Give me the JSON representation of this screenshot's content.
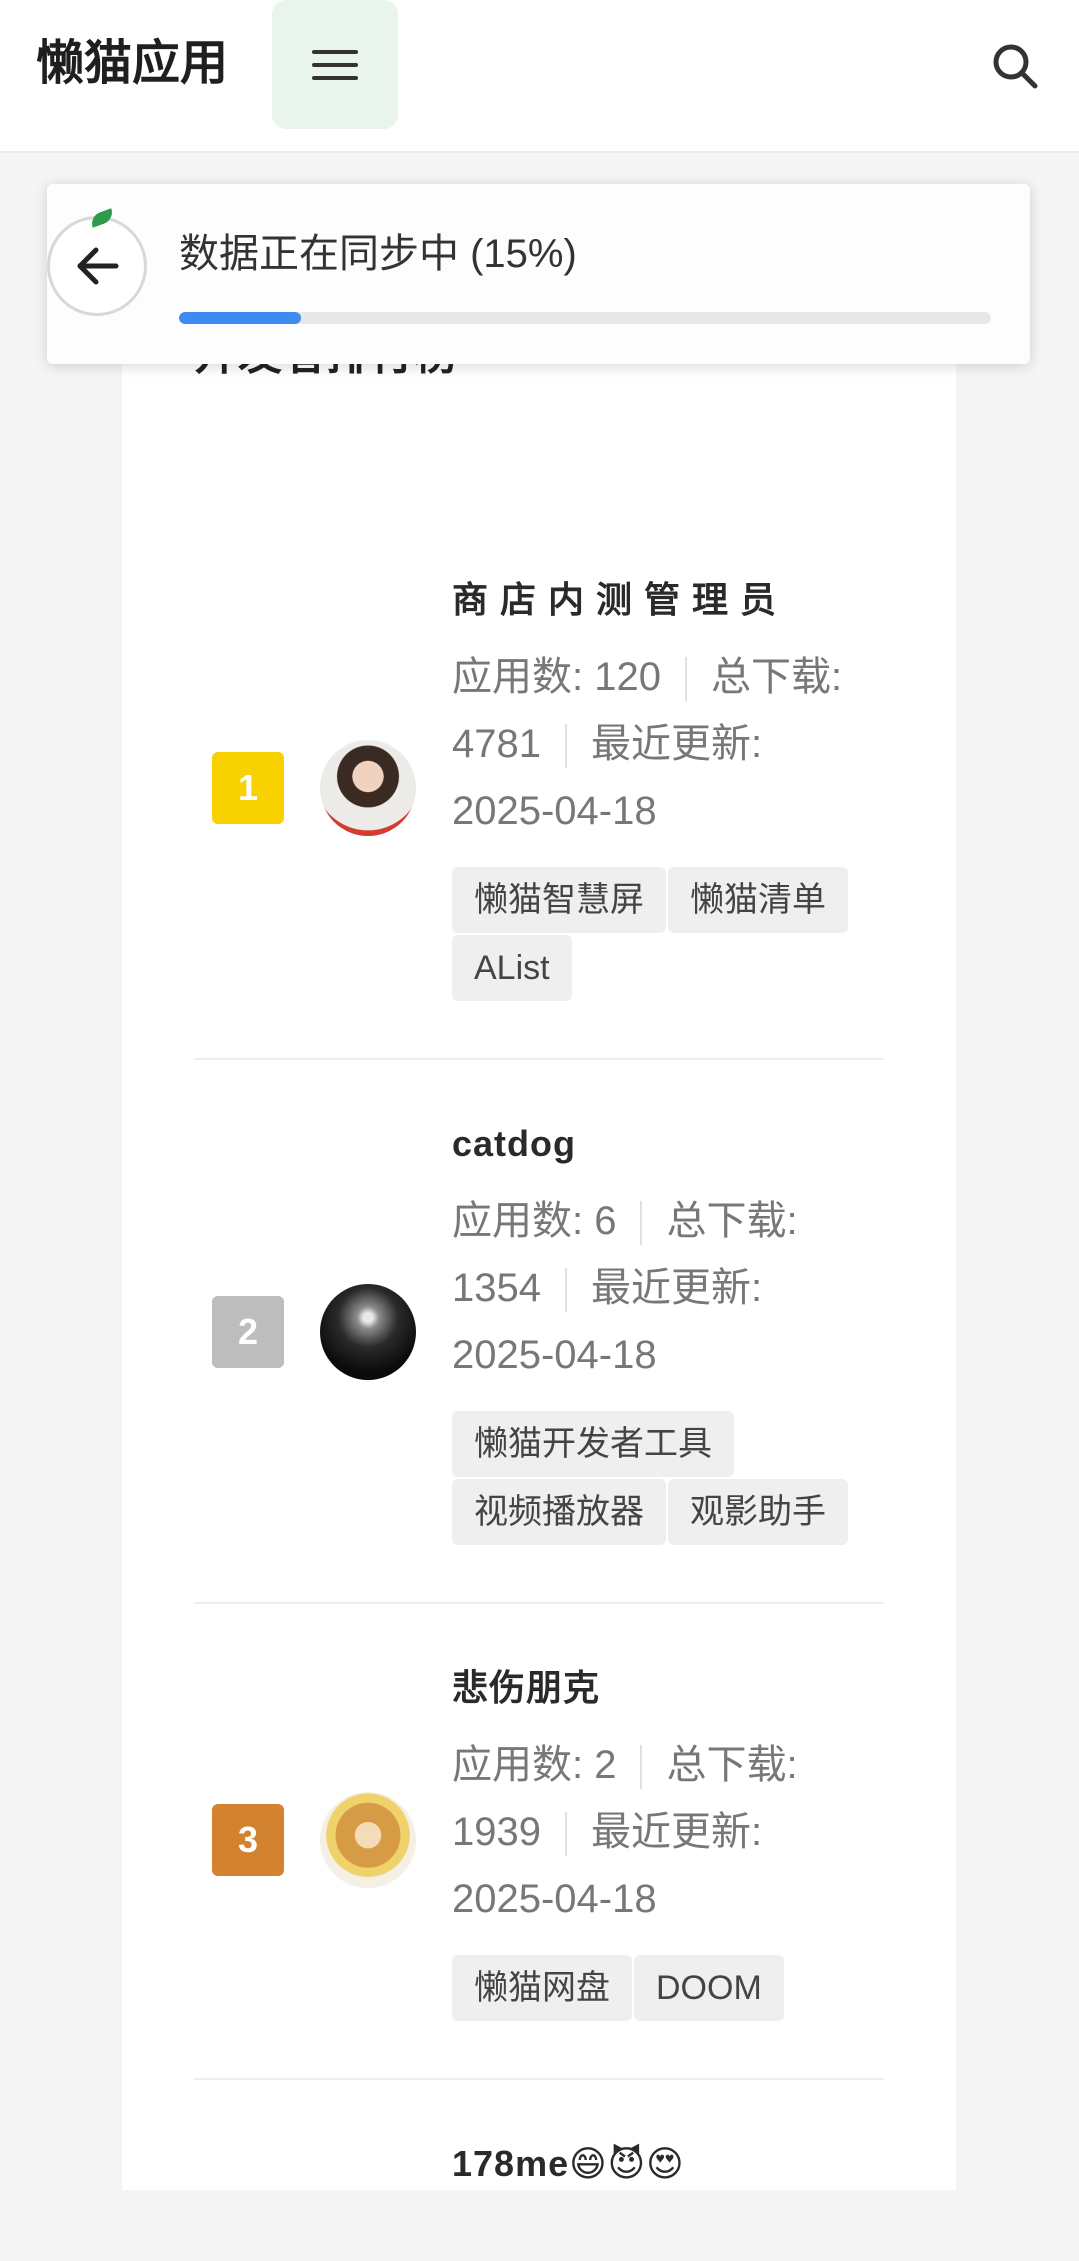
{
  "app": {
    "title": "懒猫应用"
  },
  "header": {
    "menu_icon": "menu-icon",
    "search_icon": "search-icon"
  },
  "sync": {
    "text": "数据正在同步中 (15%)",
    "progress": 0.15,
    "progress_color": "#3d8bf0",
    "back_icon": "arrow-left-icon"
  },
  "section": {
    "title": "开发者排行榜"
  },
  "developers": [
    {
      "rank": "1",
      "rank_color": "#f7d100",
      "name": "商店内测管理员",
      "apps_label": "应用数: 120",
      "downloads_label": "总下载: 4781",
      "updated_label": "最近更新: 2025-04-18",
      "tags": [
        "懒猫智慧屏",
        "懒猫清单",
        "AList"
      ]
    },
    {
      "rank": "2",
      "rank_color": "#bdbdbd",
      "name": "catdog",
      "apps_label": "应用数: 6",
      "downloads_label": "总下载: 1354",
      "updated_label": "最近更新: 2025-04-18",
      "tags": [
        "懒猫开发者工具",
        "视频播放器",
        "观影助手"
      ]
    },
    {
      "rank": "3",
      "rank_color": "#d3822f",
      "name": "悲伤朋克",
      "apps_label": "应用数: 2",
      "downloads_label": "总下载: 1939",
      "updated_label": "最近更新: 2025-04-18",
      "tags": [
        "懒猫网盘",
        "DOOM"
      ]
    },
    {
      "name": "178me😄😈😍"
    }
  ]
}
